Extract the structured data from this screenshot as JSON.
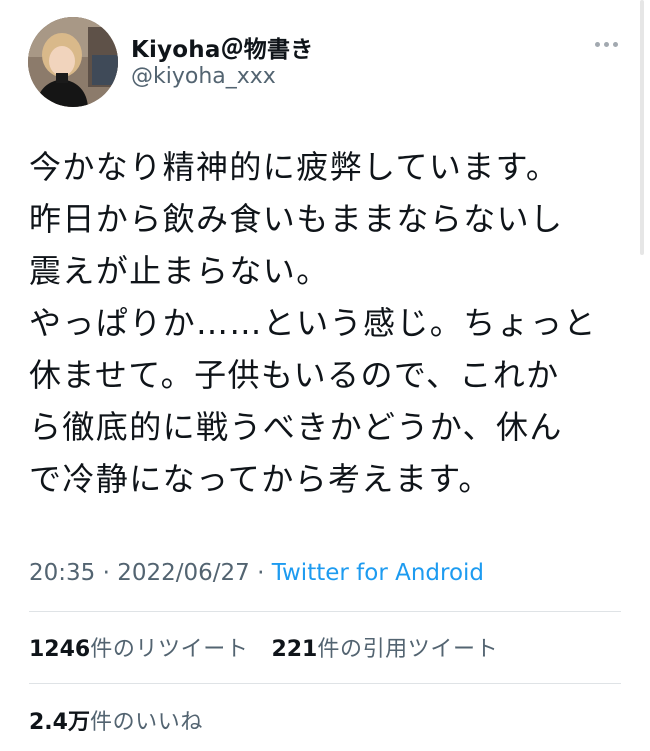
{
  "user": {
    "display_name": "Kiyoha＠物書き",
    "handle": "@kiyoha_xxx",
    "avatar_icon": "user-avatar-photo"
  },
  "tweet": {
    "lines": [
      "今かなり精神的に疲弊しています。",
      "昨日から飲み食いもままならないし",
      "震えが止まらない。",
      "やっぱりか……という感じ。ちょっと",
      "休ませて。子供もいるので、これか",
      "ら徹底的に戦うべきかどうか、休ん",
      "で冷静になってから考えます。"
    ],
    "time": "20:35",
    "separator": " · ",
    "date": "2022/06/27",
    "source": "Twitter for Android"
  },
  "stats": {
    "retweets_count": "1246",
    "retweets_label": "件のリツイート",
    "quotes_count": "221",
    "quotes_label": "件の引用ツイート",
    "likes_count": "2.4万",
    "likes_label": "件のいいね"
  },
  "colors": {
    "text": "#0f1419",
    "secondary": "#536471",
    "link": "#1d9bf0",
    "divider": "#dfe3e6"
  }
}
